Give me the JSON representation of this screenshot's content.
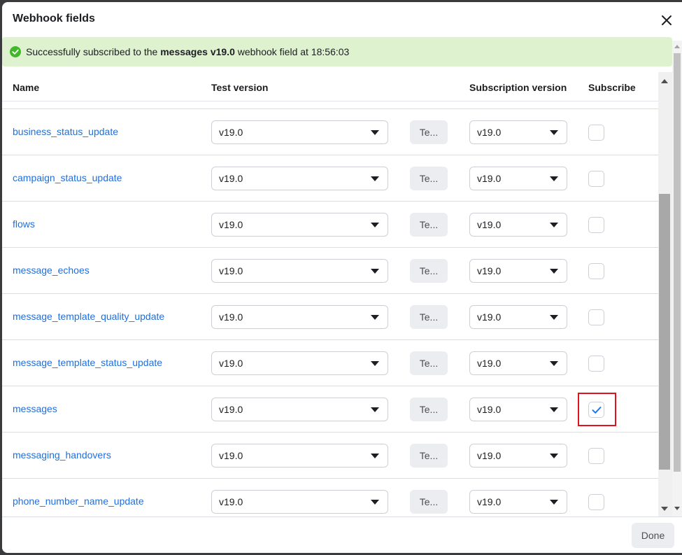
{
  "dialog": {
    "title": "Webhook fields",
    "close_icon": "close-icon"
  },
  "banner": {
    "icon": "check-circle-icon",
    "text_before": "Successfully subscribed to the ",
    "text_bold": "messages v19.0",
    "text_after": " webhook field at 18:56:03"
  },
  "columns": {
    "name": "Name",
    "test_version": "Test version",
    "subscription_version": "Subscription version",
    "subscribe": "Subscribe"
  },
  "rows": [
    {
      "name": "business_status_update",
      "test_version": "v19.0",
      "test_button": "Te...",
      "subscription_version": "v19.0",
      "subscribed": false
    },
    {
      "name": "campaign_status_update",
      "test_version": "v19.0",
      "test_button": "Te...",
      "subscription_version": "v19.0",
      "subscribed": false
    },
    {
      "name": "flows",
      "test_version": "v19.0",
      "test_button": "Te...",
      "subscription_version": "v19.0",
      "subscribed": false
    },
    {
      "name": "message_echoes",
      "test_version": "v19.0",
      "test_button": "Te...",
      "subscription_version": "v19.0",
      "subscribed": false
    },
    {
      "name": "message_template_quality_update",
      "test_version": "v19.0",
      "test_button": "Te...",
      "subscription_version": "v19.0",
      "subscribed": false
    },
    {
      "name": "message_template_status_update",
      "test_version": "v19.0",
      "test_button": "Te...",
      "subscription_version": "v19.0",
      "subscribed": false
    },
    {
      "name": "messages",
      "test_version": "v19.0",
      "test_button": "Te...",
      "subscription_version": "v19.0",
      "subscribed": true,
      "highlighted": true
    },
    {
      "name": "messaging_handovers",
      "test_version": "v19.0",
      "test_button": "Te...",
      "subscription_version": "v19.0",
      "subscribed": false
    },
    {
      "name": "phone_number_name_update",
      "test_version": "v19.0",
      "test_button": "Te...",
      "subscription_version": "v19.0",
      "subscribed": false
    }
  ],
  "footer": {
    "done_label": "Done"
  },
  "colors": {
    "link": "#216fdb",
    "banner_bg": "#def2cf",
    "success": "#42b72a",
    "check": "#1877f2",
    "highlight": "#e0131d"
  }
}
